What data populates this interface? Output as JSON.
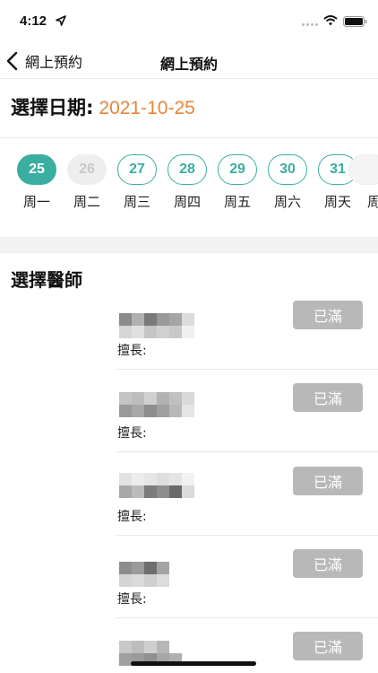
{
  "status_bar": {
    "time": "4:12",
    "icons": [
      "location-arrow-icon",
      "wifi-icon",
      "battery-icon"
    ]
  },
  "nav": {
    "back_label": "網上預約",
    "title": "網上預約"
  },
  "date_header": {
    "label": "選擇日期:",
    "value": "2021-10-25"
  },
  "days": [
    {
      "num": "25",
      "label": "周一",
      "state": "selected"
    },
    {
      "num": "26",
      "label": "周二",
      "state": "disabled"
    },
    {
      "num": "27",
      "label": "周三",
      "state": "available"
    },
    {
      "num": "28",
      "label": "周四",
      "state": "available"
    },
    {
      "num": "29",
      "label": "周五",
      "state": "available"
    },
    {
      "num": "30",
      "label": "周六",
      "state": "available"
    },
    {
      "num": "31",
      "label": "周天",
      "state": "available"
    },
    {
      "num": "",
      "label": "周",
      "state": "available"
    }
  ],
  "doctors_section": {
    "title": "選擇醫師"
  },
  "doctors": [
    {
      "specialty_label": "擅長:",
      "button_label": "已滿"
    },
    {
      "specialty_label": "擅長:",
      "button_label": "已滿"
    },
    {
      "specialty_label": "擅長:",
      "button_label": "已滿"
    },
    {
      "specialty_label": "擅長:",
      "button_label": "已滿"
    },
    {
      "specialty_label": "",
      "button_label": "已滿"
    }
  ],
  "colors": {
    "accent": "#3aaea0",
    "date": "#e8853a",
    "full_button": "#b8b8b8"
  }
}
